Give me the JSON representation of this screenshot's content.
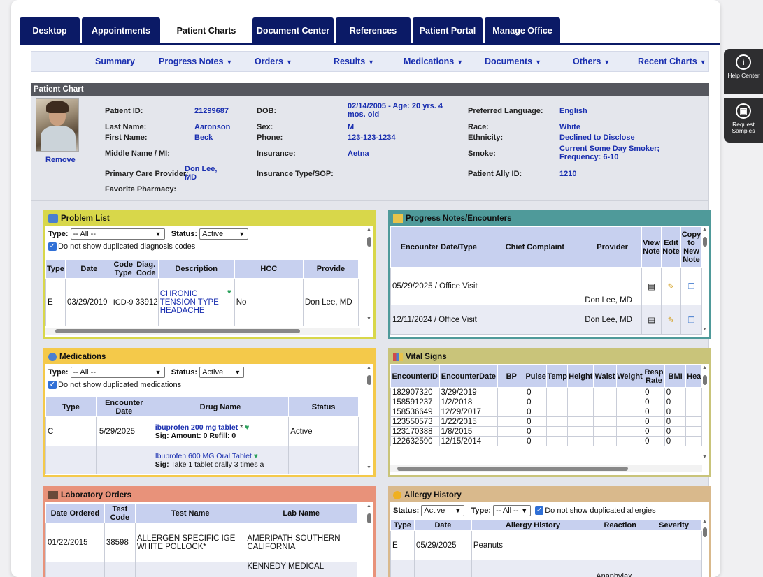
{
  "tabs": [
    "Desktop",
    "Appointments",
    "Patient Charts",
    "Document Center",
    "References",
    "Patient Portal",
    "Manage Office"
  ],
  "active_tab": "Patient Charts",
  "subnav": [
    "Summary",
    "Progress Notes",
    "Orders",
    "Results",
    "Medications",
    "Documents",
    "Others",
    "Recent Charts"
  ],
  "side": {
    "help": "Help Center",
    "samples": "Request Samples"
  },
  "patient_chart": {
    "title": "Patient Chart",
    "remove": "Remove",
    "labels": {
      "patient_id": "Patient ID:",
      "last_name": "Last Name:",
      "first_name": "First Name:",
      "middle_name": "Middle Name / MI:",
      "pcp": "Primary Care Provider:",
      "pharmacy": "Favorite Pharmacy:",
      "dob": "DOB:",
      "sex": "Sex:",
      "phone": "Phone:",
      "insurance": "Insurance:",
      "ins_type": "Insurance Type/SOP:",
      "language": "Preferred Language:",
      "race": "Race:",
      "ethnicity": "Ethnicity:",
      "smoke": "Smoke:",
      "ally_id": "Patient Ally ID:"
    },
    "values": {
      "patient_id": "21299687",
      "last_name": "Aaronson",
      "first_name": "Beck",
      "pcp": "Don Lee, MD",
      "dob": "02/14/2005 - Age: 20 yrs. 4 mos. old",
      "sex": "M",
      "phone": "123-123-1234",
      "insurance": "Aetna",
      "language": "English",
      "race": "White",
      "ethnicity": "Declined to Disclose",
      "smoke": "Current Some Day Smoker; Frequency: 6-10",
      "ally_id": "1210"
    }
  },
  "problem_list": {
    "title": "Problem List",
    "type_label": "Type:",
    "type_value": "-- All --",
    "status_label": "Status:",
    "status_value": "Active",
    "dup_label": "Do not show duplicated diagnosis codes",
    "headers": [
      "Type",
      "Date",
      "Code Type",
      "Diag. Code",
      "Description",
      "HCC",
      "Provide"
    ],
    "row": {
      "type": "E",
      "date": "03/29/2019",
      "code_type": "ICD-9",
      "diag_code": "33912",
      "description": "CHRONIC TENSION TYPE HEADACHE",
      "hcc": "No",
      "provider": "Don Lee, MD"
    }
  },
  "progress_notes": {
    "title": "Progress Notes/Encounters",
    "headers": [
      "Encounter Date/Type",
      "Chief Complaint",
      "Provider",
      "View Note",
      "Edit Note",
      "Copy to New Note"
    ],
    "rows": [
      {
        "date_type": "05/29/2025 / Office Visit",
        "complaint": "",
        "provider": "Don Lee, MD"
      },
      {
        "date_type": "12/11/2024 / Office Visit",
        "complaint": "",
        "provider": "Don Lee, MD"
      }
    ]
  },
  "medications": {
    "title": "Medications",
    "type_label": "Type:",
    "type_value": "-- All --",
    "status_label": "Status:",
    "status_value": "Active",
    "dup_label": "Do not show duplicated medications",
    "headers": [
      "Type",
      "Encounter Date",
      "Drug Name",
      "Status"
    ],
    "rows": [
      {
        "type": "C",
        "date": "5/29/2025",
        "drug": "ibuprofen 200 mg tablet",
        "mark": "*",
        "sig_label": "Sig:",
        "sig": "Amount: 0  Refill: 0",
        "status": "Active"
      },
      {
        "type": "",
        "date": "",
        "drug": "Ibuprofen 600 MG Oral Tablet",
        "mark": "",
        "sig_label": "Sig:",
        "sig": "Take 1 tablet orally 3 times a",
        "status": ""
      }
    ]
  },
  "vital_signs": {
    "title": "Vital Signs",
    "headers": [
      "EncounterID",
      "EncounterDate",
      "BP",
      "Pulse",
      "Temp",
      "Height",
      "Waist",
      "Weight",
      "Resp Rate",
      "BMI",
      "Hea"
    ],
    "rows": [
      [
        "182907320",
        "3/29/2019",
        "",
        "0",
        "",
        "",
        "",
        "",
        "0",
        "0",
        ""
      ],
      [
        "158591237",
        "1/2/2018",
        "",
        "0",
        "",
        "",
        "",
        "",
        "0",
        "0",
        ""
      ],
      [
        "158536649",
        "12/29/2017",
        "",
        "0",
        "",
        "",
        "",
        "",
        "0",
        "0",
        ""
      ],
      [
        "123550573",
        "1/22/2015",
        "",
        "0",
        "",
        "",
        "",
        "",
        "0",
        "0",
        ""
      ],
      [
        "123170388",
        "1/8/2015",
        "",
        "0",
        "",
        "",
        "",
        "",
        "0",
        "0",
        ""
      ],
      [
        "122632590",
        "12/15/2014",
        "",
        "0",
        "",
        "",
        "",
        "",
        "0",
        "0",
        ""
      ]
    ]
  },
  "lab_orders": {
    "title": "Laboratory Orders",
    "headers": [
      "Date Ordered",
      "Test Code",
      "Test Name",
      "Lab Name"
    ],
    "rows": [
      {
        "date": "01/22/2015",
        "code": "38598",
        "name": "ALLERGEN SPECIFIC IGE WHITE POLLOCK*",
        "lab": "AMERIPATH SOUTHERN CALIFORNIA"
      },
      {
        "date": "",
        "code": "",
        "name": "",
        "lab": "KENNEDY MEDICAL"
      }
    ]
  },
  "allergy": {
    "title": "Allergy History",
    "status_label": "Status:",
    "status_value": "Active",
    "type_label": "Type:",
    "type_value": "-- All --",
    "dup_label": "Do not show duplicated allergies",
    "headers": [
      "Type",
      "Date",
      "Allergy History",
      "Reaction",
      "Severity"
    ],
    "rows": [
      {
        "type": "E",
        "date": "05/29/2025",
        "allergy": "Peanuts",
        "reaction": "",
        "severity": ""
      },
      {
        "type": "",
        "date": "",
        "allergy": "",
        "reaction": "Anaphylax",
        "severity": ""
      }
    ]
  },
  "colors": {
    "nav": "#0b1a66",
    "link": "#1a2fb0",
    "problem": "#d8d74a",
    "progress": "#4f9a9a",
    "meds": "#f4c94a",
    "vitals": "#c9c47a",
    "labs": "#e8927a",
    "allergy": "#d9b98c"
  }
}
